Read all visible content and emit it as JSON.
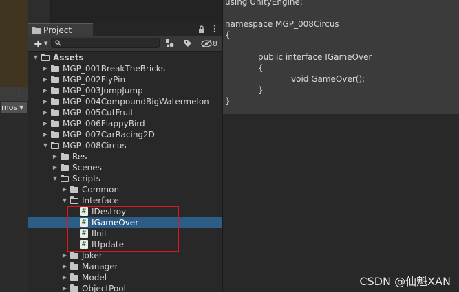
{
  "left_panel": {
    "gizmos_label": "mos",
    "kebab_glyph": "⋮"
  },
  "project_panel": {
    "tab_label": "Project",
    "lock_glyph": "🔒",
    "kebab_glyph": "⋮",
    "add_button_glyph": "+",
    "search_placeholder": "",
    "hidden_count": "8",
    "tree": [
      {
        "label": "Assets",
        "depth": 0,
        "kind": "folder",
        "expanded": true,
        "bold": true
      },
      {
        "label": "MGP_001BreakTheBricks",
        "depth": 1,
        "kind": "folder",
        "expanded": false
      },
      {
        "label": "MGP_002FlyPin",
        "depth": 1,
        "kind": "folder",
        "expanded": false
      },
      {
        "label": "MGP_003JumpJump",
        "depth": 1,
        "kind": "folder",
        "expanded": false
      },
      {
        "label": "MGP_004CompoundBigWatermelon",
        "depth": 1,
        "kind": "folder",
        "expanded": false
      },
      {
        "label": "MGP_005CutFruit",
        "depth": 1,
        "kind": "folder",
        "expanded": false
      },
      {
        "label": "MGP_006FlappyBird",
        "depth": 1,
        "kind": "folder",
        "expanded": false
      },
      {
        "label": "MGP_007CarRacing2D",
        "depth": 1,
        "kind": "folder",
        "expanded": false
      },
      {
        "label": "MGP_008Circus",
        "depth": 1,
        "kind": "folder",
        "expanded": true
      },
      {
        "label": "Res",
        "depth": 2,
        "kind": "folder",
        "expanded": false
      },
      {
        "label": "Scenes",
        "depth": 2,
        "kind": "folder",
        "expanded": false
      },
      {
        "label": "Scripts",
        "depth": 2,
        "kind": "folder",
        "expanded": true
      },
      {
        "label": "Common",
        "depth": 3,
        "kind": "folder",
        "expanded": false
      },
      {
        "label": "Interface",
        "depth": 3,
        "kind": "folder",
        "expanded": true
      },
      {
        "label": "IDestroy",
        "depth": 4,
        "kind": "script",
        "selected": false
      },
      {
        "label": "IGameOver",
        "depth": 4,
        "kind": "script",
        "selected": true
      },
      {
        "label": "IInit",
        "depth": 4,
        "kind": "script",
        "selected": false
      },
      {
        "label": "IUpdate",
        "depth": 4,
        "kind": "script",
        "selected": false
      },
      {
        "label": "Joker",
        "depth": 3,
        "kind": "folder",
        "expanded": false
      },
      {
        "label": "Manager",
        "depth": 3,
        "kind": "folder",
        "expanded": false
      },
      {
        "label": "Model",
        "depth": 3,
        "kind": "folder",
        "expanded": false
      },
      {
        "label": "ObjectPool",
        "depth": 3,
        "kind": "folder",
        "expanded": false
      }
    ]
  },
  "code_preview": {
    "lines": [
      {
        "text": "using UnityEngine;",
        "indent": 0
      },
      {
        "text": "",
        "indent": 0
      },
      {
        "text": "namespace MGP_008Circus",
        "indent": 0
      },
      {
        "text": "{",
        "indent": 0
      },
      {
        "text": "",
        "indent": 0
      },
      {
        "text": "public interface IGameOver",
        "indent": 1
      },
      {
        "text": "{",
        "indent": 1
      },
      {
        "text": "void GameOver();",
        "indent": 2
      },
      {
        "text": "}",
        "indent": 1
      },
      {
        "text": "}",
        "indent": 0
      }
    ]
  },
  "watermark": "CSDN @仙魁XAN",
  "colors": {
    "selection": "#2c5d87",
    "highlight_border": "#e0161c",
    "script_icon_fg": "#2f7d3a"
  }
}
